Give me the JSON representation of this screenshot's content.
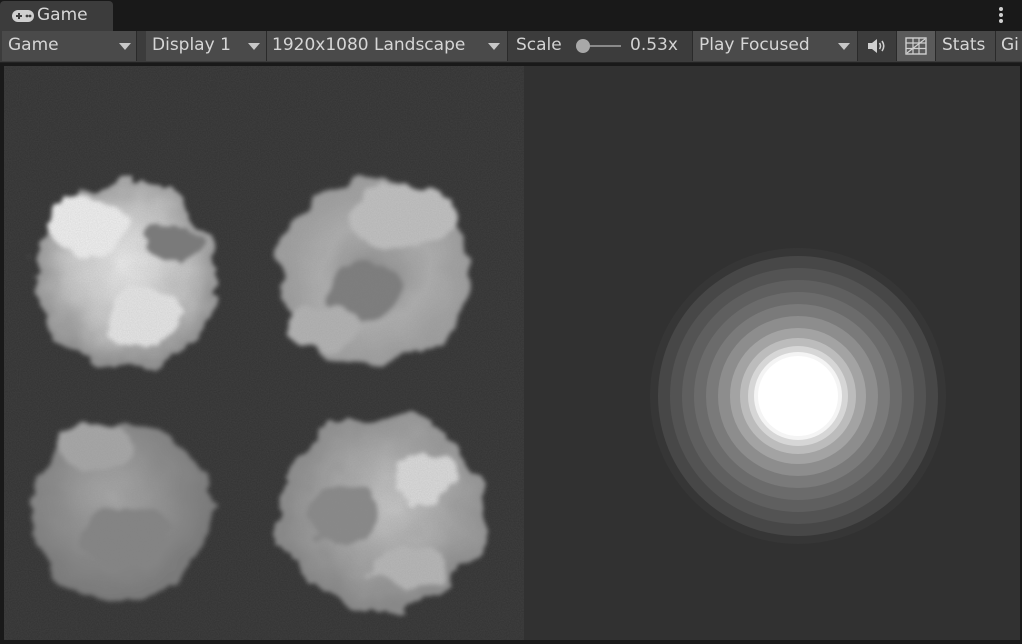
{
  "tab": {
    "label": "Game",
    "icon": "gamepad-icon"
  },
  "toolbar": {
    "view_mode": "Game",
    "display": "Display 1",
    "resolution": "1920x1080 Landscape",
    "scale_label": "Scale",
    "scale_value": "0.53x",
    "play_mode": "Play Focused",
    "audio_icon": "speaker-icon",
    "gizmo_toggle_icon": "grid-overlay-icon",
    "stats_label": "Stats",
    "gizmos_label": "Gi"
  },
  "colors": {
    "panel": "#3c3c3c",
    "viewport": "#313131",
    "tabbar": "#191919"
  }
}
